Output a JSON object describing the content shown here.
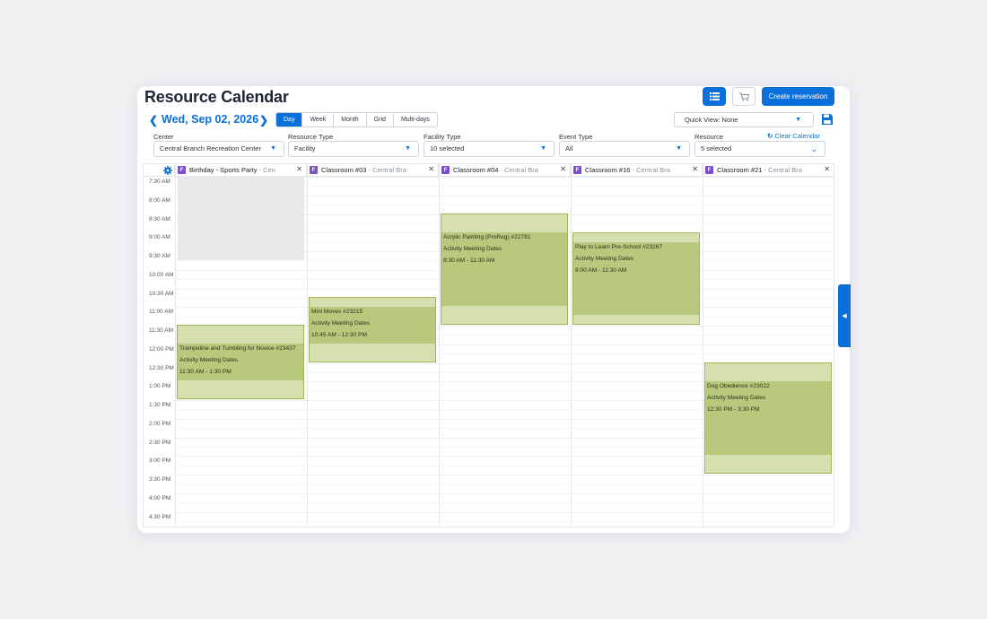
{
  "header": {
    "title": "Resource Calendar",
    "create_label": "Create reservation",
    "list_icon": "list-icon",
    "cart_icon": "cart-icon"
  },
  "datebar": {
    "date": "Wed, Sep 02, 2026",
    "views": [
      "Day",
      "Week",
      "Month",
      "Grid",
      "Multi-days"
    ],
    "active_view": "Day",
    "quick_view": "Quick View: None"
  },
  "filters": {
    "center": {
      "label": "Center",
      "value": "Central Branch Recreation Center"
    },
    "resource_type": {
      "label": "Resource Type",
      "value": "Facility"
    },
    "facility_type": {
      "label": "Facility Type",
      "value": "10 selected"
    },
    "event_type": {
      "label": "Event Type",
      "value": "All"
    },
    "resource": {
      "label": "Resource",
      "value": "5 selected"
    },
    "clear_label": "Clear Calendar"
  },
  "columns": [
    {
      "tag": "F",
      "name": "Birthday - Sports Party",
      "sub": "- Cen"
    },
    {
      "tag": "F",
      "name": "Classroom #03",
      "sub": "- Central Bra"
    },
    {
      "tag": "F",
      "name": "Classroom #04",
      "sub": "- Central Bra"
    },
    {
      "tag": "F",
      "name": "Classroom #16",
      "sub": "- Central Bra"
    },
    {
      "tag": "F",
      "name": "Classroom #21",
      "sub": "- Central Bra"
    }
  ],
  "times": [
    "7:30 AM",
    "8:00 AM",
    "8:30 AM",
    "9:00 AM",
    "9:30 AM",
    "10:00 AM",
    "10:30 AM",
    "11:00 AM",
    "11:30 AM",
    "12:00 PM",
    "12:30 PM",
    "1:00 PM",
    "1:30 PM",
    "2:00 PM",
    "2:30 PM",
    "3:00 PM",
    "3:30 PM",
    "4:00 PM",
    "4:30 PM"
  ],
  "events": [
    {
      "title": "Trampoline and Tumbling for Novice #23437",
      "type": "Activity Meeting Dates",
      "time": "11:30 AM - 1:30 PM"
    },
    {
      "title": "Mini Moves #23215",
      "type": "Activity Meeting Dates",
      "time": "10:45 AM - 12:30 PM"
    },
    {
      "title": "Acrylic Painting (ProReg) #22781",
      "type": "Activity Meeting Dates",
      "time": "8:30 AM - 11:30 AM"
    },
    {
      "title": "Play to Learn Pre-School #23267",
      "type": "Activity Meeting Dates",
      "time": "9:00 AM - 11:30 AM"
    },
    {
      "title": "Dog Obedience #23022",
      "type": "Activity Meeting Dates",
      "time": "12:30 PM - 3:30 PM"
    }
  ],
  "colors": {
    "accent": "#0a6fd8",
    "event_fill": "#b7c97c",
    "event_band": "#d5e0ae",
    "facility_tag": "#7a4fc9"
  }
}
